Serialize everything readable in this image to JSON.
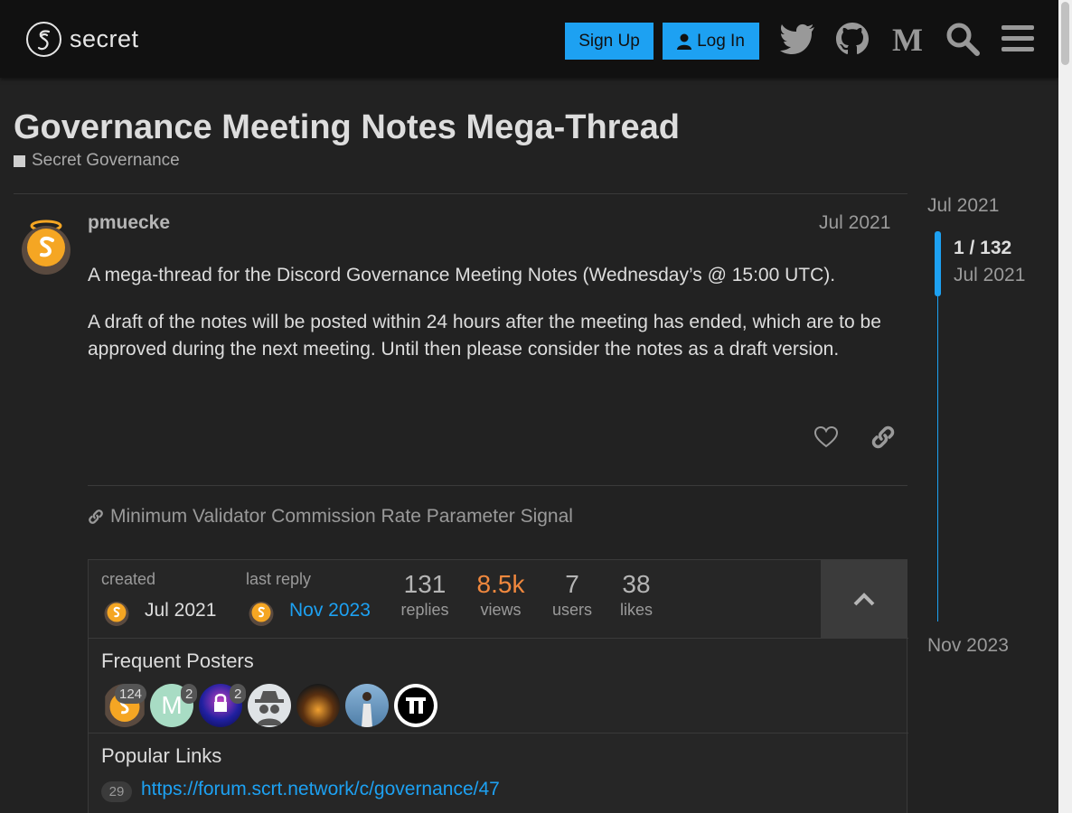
{
  "header": {
    "logo_text": "secret",
    "signup_label": "Sign Up",
    "login_label": "Log In",
    "icons": [
      "twitter-icon",
      "github-icon",
      "medium-icon",
      "search-icon",
      "hamburger-menu-icon"
    ]
  },
  "topic": {
    "title": "Governance Meeting Notes Mega-Thread",
    "category": "Secret Governance"
  },
  "post": {
    "username": "pmuecke",
    "date": "Jul 2021",
    "paragraphs": [
      "A mega-thread for the Discord Governance Meeting Notes (Wednesday’s @ 15:00 UTC).",
      "A draft of the notes will be posted within 24 hours after the meeting has ended, which are to be approved during the next meeting. Until then please consider the notes as a draft version."
    ],
    "linked_topic": "Minimum Validator Commission Rate Parameter Signal"
  },
  "topic_map": {
    "created_label": "created",
    "created_date": "Jul 2021",
    "last_reply_label": "last reply",
    "last_reply_date": "Nov 2023",
    "stats": [
      {
        "value": "131",
        "label": "replies"
      },
      {
        "value": "8.5k",
        "label": "views"
      },
      {
        "value": "7",
        "label": "users"
      },
      {
        "value": "38",
        "label": "likes"
      }
    ],
    "frequent_posters_title": "Frequent Posters",
    "poster_counts": [
      "124",
      "2",
      "2"
    ],
    "poster_letter": "M",
    "popular_links_title": "Popular Links",
    "popular_links": [
      {
        "count": "29",
        "url": "https://forum.scrt.network/c/governance/47"
      }
    ]
  },
  "timeline": {
    "start": "Jul 2021",
    "position": "1 / 132",
    "position_date": "Jul 2021",
    "end": "Nov 2023"
  },
  "colors": {
    "accent": "#1da1f2",
    "views_highlight": "#f0883e",
    "background": "#222222",
    "header_bg": "#111111"
  }
}
